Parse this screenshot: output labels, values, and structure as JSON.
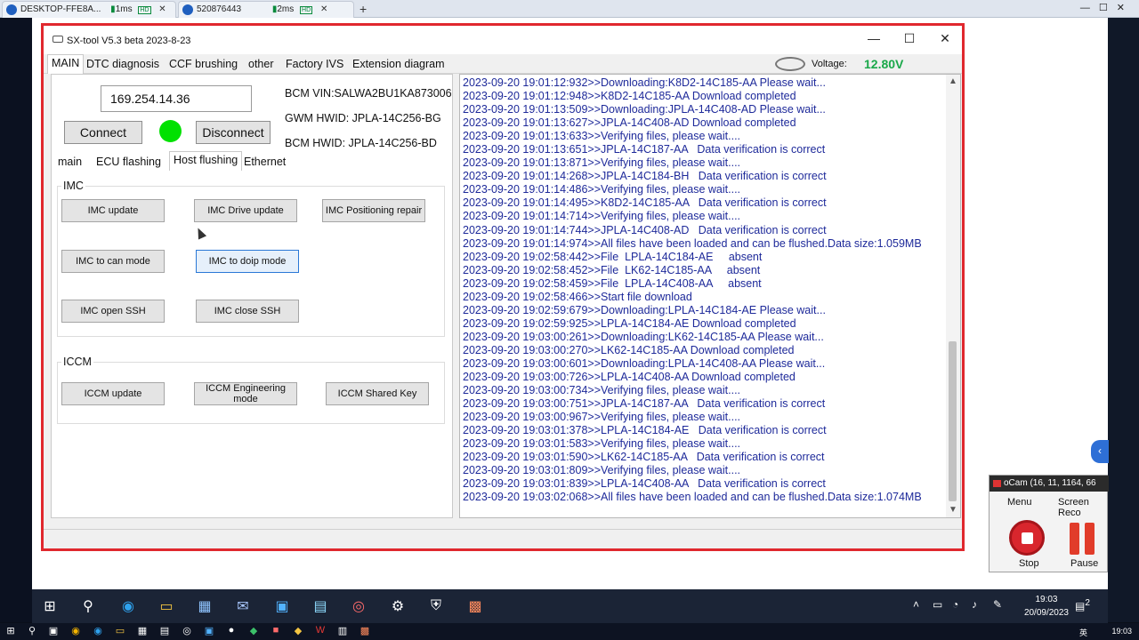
{
  "host_tabs": [
    {
      "label": "DESKTOP-FFE8A...",
      "latency": "1ms",
      "hd": "HD"
    },
    {
      "label": "520876443",
      "latency": "2ms",
      "hd": "HD"
    }
  ],
  "window": {
    "title": "SX-tool V5.3 beta 2023-8-23",
    "minimize": "—",
    "maximize": "☐",
    "close": "✕"
  },
  "menu": {
    "items": [
      "MAIN",
      "DTC diagnosis",
      "CCF brushing",
      "other",
      "Factory IVS",
      "Extension diagram"
    ],
    "active": "MAIN"
  },
  "voltage": {
    "label": "Voltage:",
    "value": "12.80V",
    "color": "#1aa84a"
  },
  "connection": {
    "ip": "169.254.14.36",
    "connect_label": "Connect",
    "disconnect_label": "Disconnect",
    "status_color": "#00e100",
    "bcm_vin": "BCM VIN:SALWA2BU1KA873006",
    "gwm_hwid": "GWM HWID: JPLA-14C256-BG",
    "bcm_hwid": "BCM HWID: JPLA-14C256-BD"
  },
  "subtabs": {
    "items": [
      "main",
      "ECU flashing",
      "Host flushing",
      "Ethernet"
    ],
    "active": "Host flushing"
  },
  "imc": {
    "title": "IMC",
    "buttons": {
      "update": "IMC update",
      "drive_update": "IMC Drive update",
      "positioning_repair": "IMC Positioning repair",
      "to_can": "IMC to can mode",
      "to_doip": "IMC to doip mode",
      "open_ssh": "IMC open SSH",
      "close_ssh": "IMC close SSH"
    }
  },
  "iccm": {
    "title": "ICCM",
    "buttons": {
      "update": "ICCM update",
      "engineering": "ICCM Engineering mode",
      "shared_key": "ICCM Shared Key"
    }
  },
  "log": [
    "2023-09-20 19:01:12:932>>Downloading:K8D2-14C185-AA Please wait...",
    "2023-09-20 19:01:12:948>>K8D2-14C185-AA Download completed",
    "2023-09-20 19:01:13:509>>Downloading:JPLA-14C408-AD Please wait...",
    "2023-09-20 19:01:13:627>>JPLA-14C408-AD Download completed",
    "2023-09-20 19:01:13:633>>Verifying files, please wait....",
    "2023-09-20 19:01:13:651>>JPLA-14C187-AA   Data verification is correct",
    "2023-09-20 19:01:13:871>>Verifying files, please wait....",
    "2023-09-20 19:01:14:268>>JPLA-14C184-BH   Data verification is correct",
    "2023-09-20 19:01:14:486>>Verifying files, please wait....",
    "2023-09-20 19:01:14:495>>K8D2-14C185-AA   Data verification is correct",
    "2023-09-20 19:01:14:714>>Verifying files, please wait....",
    "2023-09-20 19:01:14:744>>JPLA-14C408-AD   Data verification is correct",
    "2023-09-20 19:01:14:974>>All files have been loaded and can be flushed.Data size:1.059MB",
    "2023-09-20 19:02:58:442>>File  LPLA-14C184-AE     absent",
    "2023-09-20 19:02:58:452>>File  LK62-14C185-AA     absent",
    "2023-09-20 19:02:58:459>>File  LPLA-14C408-AA     absent",
    "2023-09-20 19:02:58:466>>Start file download",
    "2023-09-20 19:02:59:679>>Downloading:LPLA-14C184-AE Please wait...",
    "2023-09-20 19:02:59:925>>LPLA-14C184-AE Download completed",
    "2023-09-20 19:03:00:261>>Downloading:LK62-14C185-AA Please wait...",
    "2023-09-20 19:03:00:270>>LK62-14C185-AA Download completed",
    "2023-09-20 19:03:00:601>>Downloading:LPLA-14C408-AA Please wait...",
    "2023-09-20 19:03:00:726>>LPLA-14C408-AA Download completed",
    "2023-09-20 19:03:00:734>>Verifying files, please wait....",
    "2023-09-20 19:03:00:751>>JPLA-14C187-AA   Data verification is correct",
    "2023-09-20 19:03:00:967>>Verifying files, please wait....",
    "2023-09-20 19:03:01:378>>LPLA-14C184-AE   Data verification is correct",
    "2023-09-20 19:03:01:583>>Verifying files, please wait....",
    "2023-09-20 19:03:01:590>>LK62-14C185-AA   Data verification is correct",
    "2023-09-20 19:03:01:809>>Verifying files, please wait....",
    "2023-09-20 19:03:01:839>>LPLA-14C408-AA   Data verification is correct",
    "2023-09-20 19:03:02:068>>All files have been loaded and can be flushed.Data size:1.074MB"
  ],
  "ocam": {
    "title": "oCam (16, 11, 1164, 66",
    "menu_label": "Menu",
    "screen_rec_label": "Screen Reco",
    "stop_label": "Stop",
    "pause_label": "Pause"
  },
  "taskbar": {
    "time": "19:03",
    "date": "20/09/2023",
    "notification_count": "2"
  },
  "host_taskbar": {
    "time": "19:03",
    "lang": "英"
  },
  "colors": {
    "frame_border": "#e0282e",
    "log_text": "#1e2a9a"
  }
}
